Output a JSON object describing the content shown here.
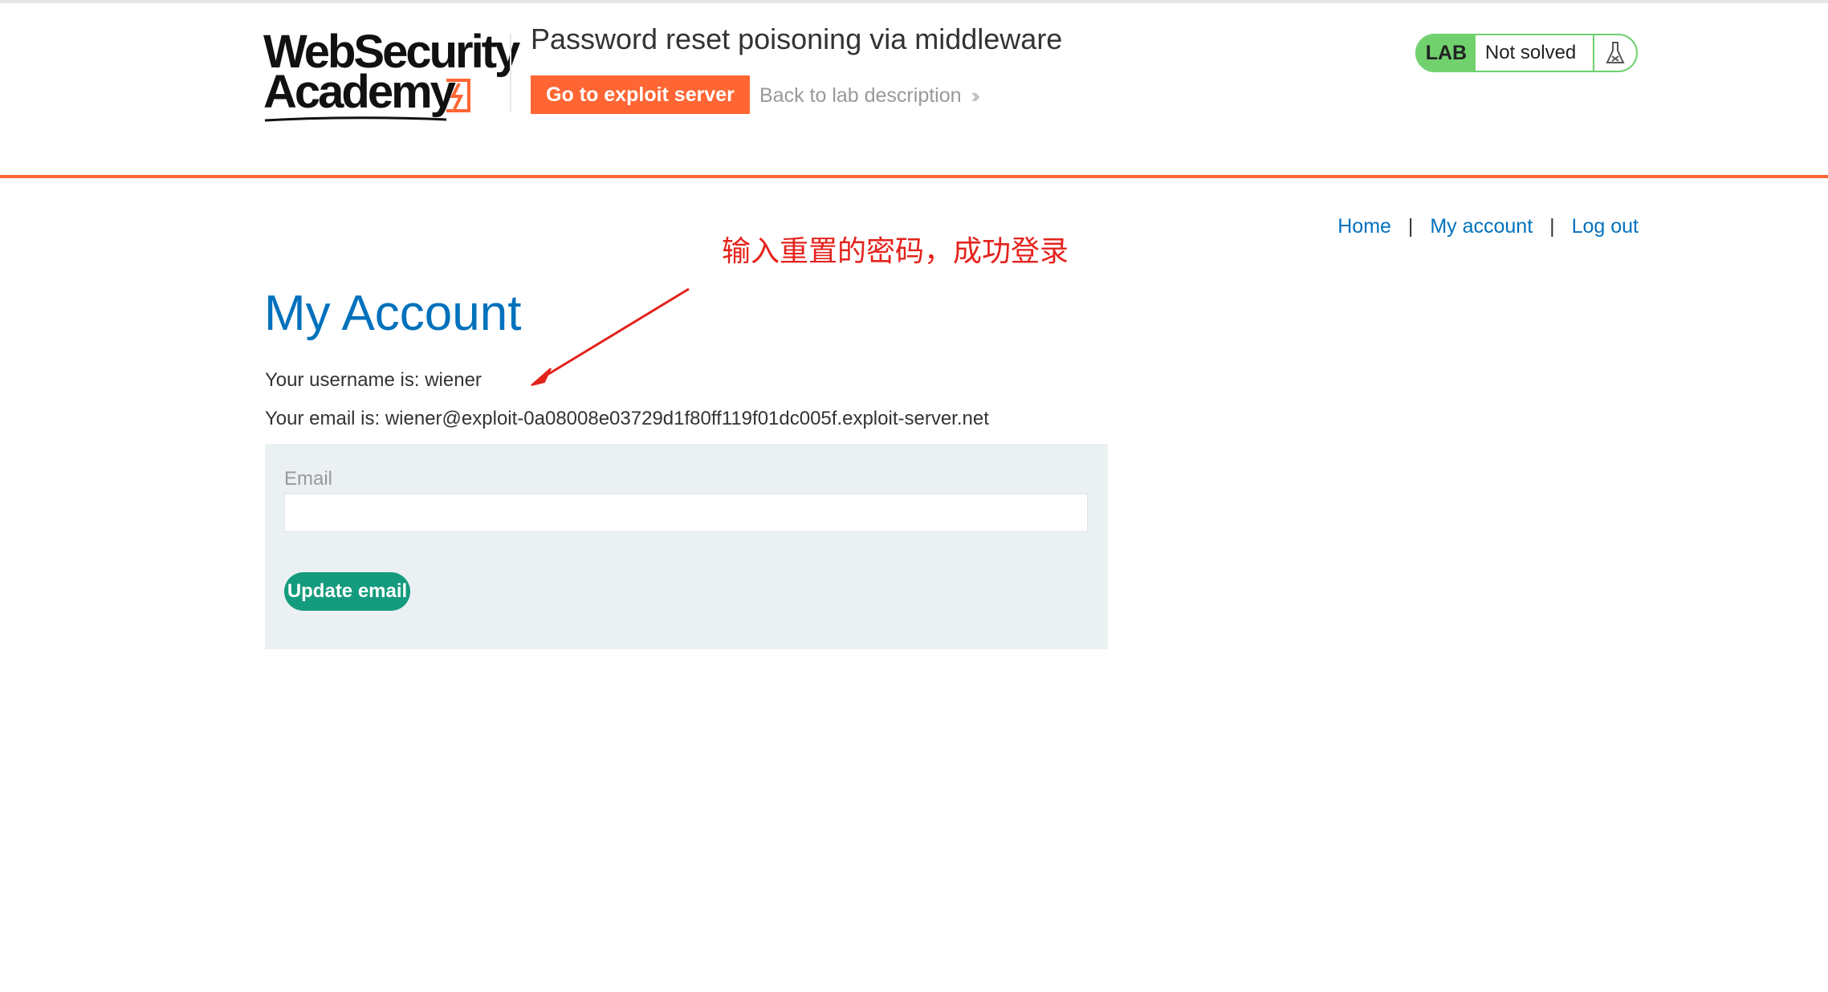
{
  "header": {
    "logo_line1": "WebSecurity",
    "logo_line2": "Academy",
    "lab_title": "Password reset poisoning via middleware",
    "exploit_button": "Go to exploit server",
    "back_link": "Back to lab description",
    "back_link_icon": "double-chevron-right-icon",
    "status_badge": "LAB",
    "status_text": "Not solved",
    "status_icon": "flask-icon"
  },
  "nav": {
    "home": "Home",
    "account": "My account",
    "logout": "Log out",
    "separator": "|"
  },
  "annotation": {
    "text": "输入重置的密码，成功登录",
    "color": "#e4221c"
  },
  "main": {
    "title": "My Account",
    "username_line": "Your username is: wiener",
    "email_line": "Your email is: wiener@exploit-0a08008e03729d1f80ff119f01dc005f.exploit-server.net",
    "form": {
      "email_label": "Email",
      "email_value": "",
      "update_button": "Update email"
    }
  },
  "colors": {
    "accent_orange": "#ff6633",
    "link_blue": "#0071bc",
    "lab_green": "#70d16d",
    "button_teal": "#149b7d",
    "form_bg": "#ebf0f2"
  }
}
